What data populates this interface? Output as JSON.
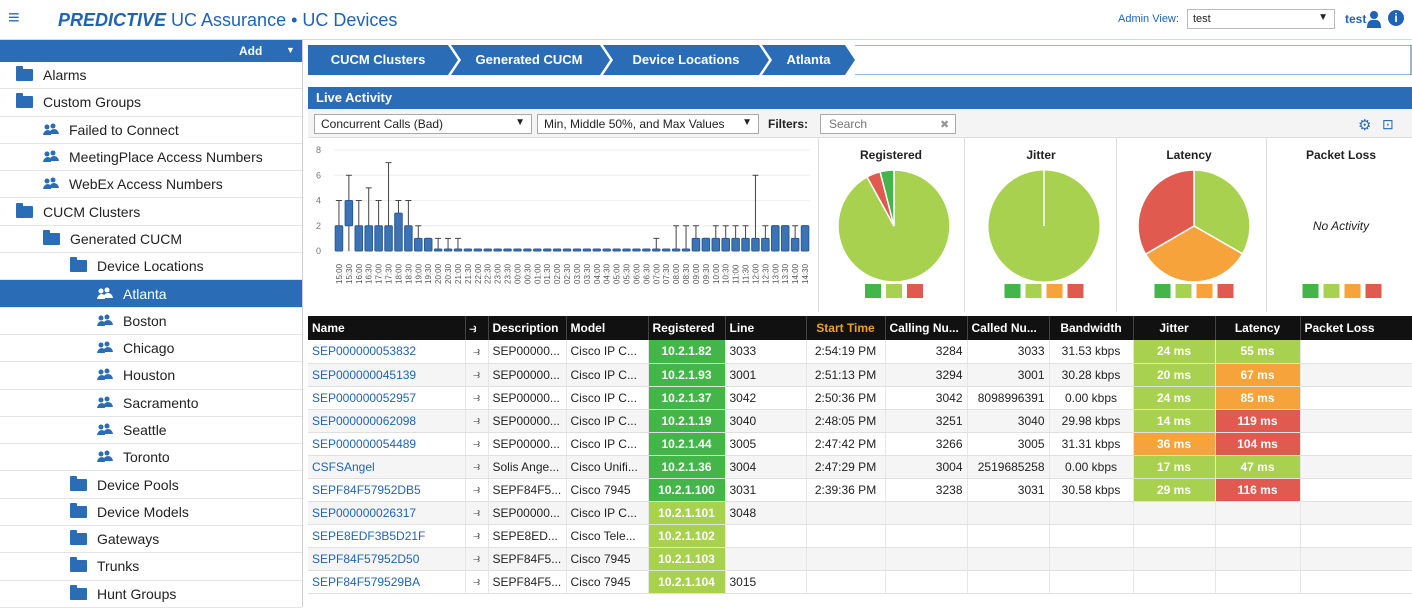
{
  "header": {
    "app_brand": "PREDICTIVE",
    "app_rest": " UC Assurance • UC Devices",
    "admin_label": "Admin View:",
    "admin_value": "test",
    "user": "test"
  },
  "sidebar": {
    "add_label": "Add",
    "items": [
      {
        "label": "Alarms",
        "icon": "folder-icon",
        "indent": 0,
        "selected": false
      },
      {
        "label": "Custom Groups",
        "icon": "folder-icon",
        "indent": 0,
        "selected": false
      },
      {
        "label": "Failed to Connect",
        "icon": "group-icon",
        "indent": 1,
        "selected": false
      },
      {
        "label": "MeetingPlace Access Numbers",
        "icon": "group-icon",
        "indent": 1,
        "selected": false
      },
      {
        "label": "WebEx Access Numbers",
        "icon": "group-icon",
        "indent": 1,
        "selected": false
      },
      {
        "label": "CUCM Clusters",
        "icon": "folder-icon",
        "indent": 0,
        "selected": false
      },
      {
        "label": "Generated CUCM",
        "icon": "folder-icon",
        "indent": 1,
        "selected": false
      },
      {
        "label": "Device Locations",
        "icon": "folder-icon",
        "indent": 2,
        "selected": false
      },
      {
        "label": "Atlanta",
        "icon": "group-icon",
        "indent": 3,
        "selected": true
      },
      {
        "label": "Boston",
        "icon": "group-icon",
        "indent": 3,
        "selected": false
      },
      {
        "label": "Chicago",
        "icon": "group-icon",
        "indent": 3,
        "selected": false
      },
      {
        "label": "Houston",
        "icon": "group-icon",
        "indent": 3,
        "selected": false
      },
      {
        "label": "Sacramento",
        "icon": "group-icon",
        "indent": 3,
        "selected": false
      },
      {
        "label": "Seattle",
        "icon": "group-icon",
        "indent": 3,
        "selected": false
      },
      {
        "label": "Toronto",
        "icon": "group-icon",
        "indent": 3,
        "selected": false
      },
      {
        "label": "Device Pools",
        "icon": "folder-icon",
        "indent": 2,
        "selected": false
      },
      {
        "label": "Device Models",
        "icon": "folder-icon",
        "indent": 2,
        "selected": false
      },
      {
        "label": "Gateways",
        "icon": "folder-icon",
        "indent": 2,
        "selected": false
      },
      {
        "label": "Trunks",
        "icon": "folder-icon",
        "indent": 2,
        "selected": false
      },
      {
        "label": "Hunt Groups",
        "icon": "folder-icon",
        "indent": 2,
        "selected": false
      }
    ]
  },
  "breadcrumb": [
    "CUCM Clusters",
    "Generated CUCM",
    "Device Locations",
    "Atlanta"
  ],
  "live": {
    "title": "Live Activity",
    "metric_select": "Concurrent Calls (Bad)",
    "range_select": "Min, Middle 50%, and Max Values",
    "filters_label": "Filters:",
    "search_placeholder": "Search"
  },
  "chart_data": {
    "type": "box",
    "ylim": [
      0,
      8
    ],
    "yticks": [
      0,
      2,
      4,
      6,
      8
    ],
    "categories": [
      "15:00",
      "15:30",
      "16:00",
      "16:30",
      "17:00",
      "17:30",
      "18:00",
      "18:30",
      "19:00",
      "19:30",
      "20:00",
      "20:30",
      "21:00",
      "21:30",
      "22:00",
      "22:30",
      "23:00",
      "23:30",
      "00:00",
      "00:30",
      "01:00",
      "01:30",
      "02:00",
      "02:30",
      "03:00",
      "03:30",
      "04:00",
      "04:30",
      "05:00",
      "05:30",
      "06:00",
      "06:30",
      "07:00",
      "07:30",
      "08:00",
      "08:30",
      "09:00",
      "09:30",
      "10:00",
      "10:30",
      "11:00",
      "11:30",
      "12:00",
      "12:30",
      "13:00",
      "13:30",
      "14:00",
      "14:30"
    ],
    "min": [
      0,
      0,
      0,
      0,
      0,
      0,
      0,
      0,
      0,
      0,
      0,
      0,
      0,
      0,
      0,
      0,
      0,
      0,
      0,
      0,
      0,
      0,
      0,
      0,
      0,
      0,
      0,
      0,
      0,
      0,
      0,
      0,
      0,
      0,
      0,
      0,
      0,
      0,
      0,
      0,
      0,
      0,
      0,
      0,
      0,
      0,
      0,
      0
    ],
    "q1": [
      0,
      2,
      0,
      0,
      0,
      0,
      0,
      0,
      0,
      0,
      0,
      0,
      0,
      0,
      0,
      0,
      0,
      0,
      0,
      0,
      0,
      0,
      0,
      0,
      0,
      0,
      0,
      0,
      0,
      0,
      0,
      0,
      0,
      0,
      0,
      0,
      0,
      0,
      0,
      0,
      0,
      0,
      0,
      0,
      0,
      0,
      0,
      0
    ],
    "q3": [
      2,
      4,
      2,
      2,
      2,
      2,
      3,
      2,
      1,
      1,
      0,
      0,
      0,
      0,
      0,
      0,
      0,
      0,
      0,
      0,
      0,
      0,
      0,
      0,
      0,
      0,
      0,
      0,
      0,
      0,
      0,
      0,
      0,
      0,
      0,
      0,
      1,
      1,
      1,
      1,
      1,
      1,
      1,
      1,
      2,
      2,
      1,
      2
    ],
    "max": [
      4,
      6,
      4,
      5,
      4,
      7,
      4,
      4,
      2,
      1,
      1,
      1,
      1,
      0,
      0,
      0,
      0,
      0,
      0,
      0,
      0,
      0,
      0,
      0,
      0,
      0,
      0,
      0,
      0,
      0,
      0,
      0,
      1,
      0,
      2,
      2,
      2,
      1,
      2,
      2,
      2,
      2,
      6,
      2,
      2,
      2,
      2,
      2
    ]
  },
  "pies": [
    {
      "title": "Registered",
      "slices": [
        {
          "value": 92,
          "color": "#a8d14f"
        },
        {
          "value": 4,
          "color": "#e05a4f"
        },
        {
          "value": 4,
          "color": "#44b549"
        }
      ],
      "legend": [
        "#44b549",
        "#a8d14f",
        "#e05a4f"
      ]
    },
    {
      "title": "Jitter",
      "slices": [
        {
          "value": 100,
          "color": "#a8d14f"
        }
      ],
      "legend": [
        "#44b549",
        "#a8d14f",
        "#f5a33a",
        "#e05a4f"
      ]
    },
    {
      "title": "Latency",
      "slices": [
        {
          "value": 33.3,
          "color": "#a8d14f"
        },
        {
          "value": 33.3,
          "color": "#f5a33a"
        },
        {
          "value": 33.4,
          "color": "#e05a4f"
        }
      ],
      "legend": [
        "#44b549",
        "#a8d14f",
        "#f5a33a",
        "#e05a4f"
      ]
    },
    {
      "title": "Packet Loss",
      "slices": [],
      "no_activity": "No Activity",
      "legend": [
        "#44b549",
        "#a8d14f",
        "#f5a33a",
        "#e05a4f"
      ]
    }
  ],
  "table": {
    "headers": [
      "Name",
      "",
      "Description",
      "Model",
      "Registered",
      "Line",
      "Start Time",
      "Calling Nu...",
      "Called Nu...",
      "Bandwidth",
      "Jitter",
      "Latency",
      "Packet Loss"
    ],
    "rows": [
      {
        "name": "SEP000000053832",
        "desc": "SEP00000...",
        "model": "Cisco IP C...",
        "reg": "10.2.1.82",
        "line": "3033",
        "start": "2:54:19 PM",
        "calling": "3284",
        "called": "3033",
        "bw": "31.53 kbps",
        "jitter": "24 ms",
        "latency": "55 ms",
        "loss": "",
        "regc": "#44b549",
        "jc": "#a8d14f",
        "lc": "#a8d14f"
      },
      {
        "name": "SEP000000045139",
        "desc": "SEP00000...",
        "model": "Cisco IP C...",
        "reg": "10.2.1.93",
        "line": "3001",
        "start": "2:51:13 PM",
        "calling": "3294",
        "called": "3001",
        "bw": "30.28 kbps",
        "jitter": "20 ms",
        "latency": "67 ms",
        "loss": "",
        "regc": "#44b549",
        "jc": "#a8d14f",
        "lc": "#f5a33a"
      },
      {
        "name": "SEP000000052957",
        "desc": "SEP00000...",
        "model": "Cisco IP C...",
        "reg": "10.2.1.37",
        "line": "3042",
        "start": "2:50:36 PM",
        "calling": "3042",
        "called": "8098996391",
        "bw": "0.00 kbps",
        "jitter": "24 ms",
        "latency": "85 ms",
        "loss": "",
        "regc": "#44b549",
        "jc": "#a8d14f",
        "lc": "#f5a33a"
      },
      {
        "name": "SEP000000062098",
        "desc": "SEP00000...",
        "model": "Cisco IP C...",
        "reg": "10.2.1.19",
        "line": "3040",
        "start": "2:48:05 PM",
        "calling": "3251",
        "called": "3040",
        "bw": "29.98 kbps",
        "jitter": "14 ms",
        "latency": "119 ms",
        "loss": "",
        "regc": "#44b549",
        "jc": "#a8d14f",
        "lc": "#e05a4f"
      },
      {
        "name": "SEP000000054489",
        "desc": "SEP00000...",
        "model": "Cisco IP C...",
        "reg": "10.2.1.44",
        "line": "3005",
        "start": "2:47:42 PM",
        "calling": "3266",
        "called": "3005",
        "bw": "31.31 kbps",
        "jitter": "36 ms",
        "latency": "104 ms",
        "loss": "",
        "regc": "#44b549",
        "jc": "#f5a33a",
        "lc": "#e05a4f"
      },
      {
        "name": "CSFSAngel",
        "desc": "Solis Ange...",
        "model": "Cisco Unifi...",
        "reg": "10.2.1.36",
        "line": "3004",
        "start": "2:47:29 PM",
        "calling": "3004",
        "called": "2519685258",
        "bw": "0.00 kbps",
        "jitter": "17 ms",
        "latency": "47 ms",
        "loss": "",
        "regc": "#44b549",
        "jc": "#a8d14f",
        "lc": "#a8d14f"
      },
      {
        "name": "SEPF84F57952DB5",
        "desc": "SEPF84F5...",
        "model": "Cisco 7945",
        "reg": "10.2.1.100",
        "line": "3031",
        "start": "2:39:36 PM",
        "calling": "3238",
        "called": "3031",
        "bw": "30.58 kbps",
        "jitter": "29 ms",
        "latency": "116 ms",
        "loss": "",
        "regc": "#44b549",
        "jc": "#a8d14f",
        "lc": "#e05a4f"
      },
      {
        "name": "SEP000000026317",
        "desc": "SEP00000...",
        "model": "Cisco IP C...",
        "reg": "10.2.1.101",
        "line": "3048",
        "start": "",
        "calling": "",
        "called": "",
        "bw": "",
        "jitter": "",
        "latency": "",
        "loss": "",
        "regc": "#a8d14f",
        "jc": "",
        "lc": ""
      },
      {
        "name": "SEPE8EDF3B5D21F",
        "desc": "SEPE8ED...",
        "model": "Cisco Tele...",
        "reg": "10.2.1.102",
        "line": "",
        "start": "",
        "calling": "",
        "called": "",
        "bw": "",
        "jitter": "",
        "latency": "",
        "loss": "",
        "regc": "#a8d14f",
        "jc": "",
        "lc": ""
      },
      {
        "name": "SEPF84F57952D50",
        "desc": "SEPF84F5...",
        "model": "Cisco 7945",
        "reg": "10.2.1.103",
        "line": "",
        "start": "",
        "calling": "",
        "called": "",
        "bw": "",
        "jitter": "",
        "latency": "",
        "loss": "",
        "regc": "#a8d14f",
        "jc": "",
        "lc": ""
      },
      {
        "name": "SEPF84F579529BA",
        "desc": "SEPF84F5...",
        "model": "Cisco 7945",
        "reg": "10.2.1.104",
        "line": "3015",
        "start": "",
        "calling": "",
        "called": "",
        "bw": "",
        "jitter": "",
        "latency": "",
        "loss": "",
        "regc": "#a8d14f",
        "jc": "",
        "lc": ""
      }
    ]
  }
}
